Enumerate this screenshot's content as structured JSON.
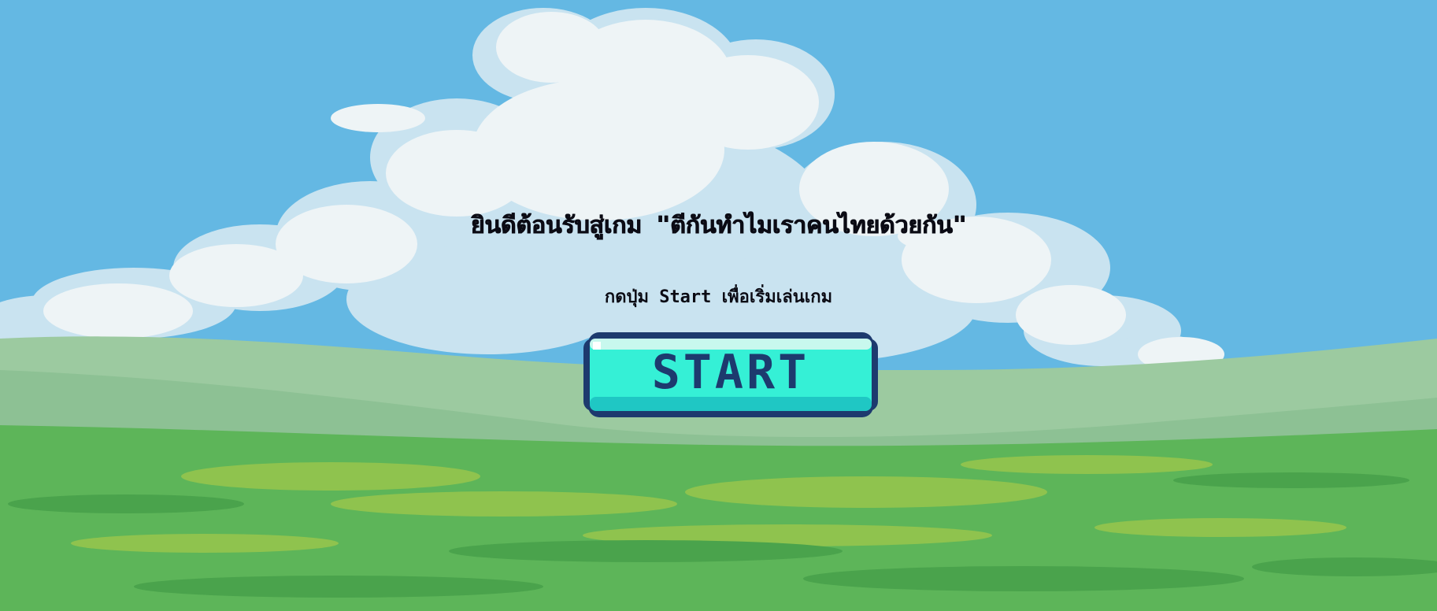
{
  "screen": {
    "title": "ยินดีต้อนรับสู่เกม \"ตีกันทำไมเราคนไทยด้วยกัน\"",
    "subtitle": "กดปุ่ม Start เพื่อเริ่มเล่นเกม",
    "start_button_label": "START"
  },
  "colors": {
    "sky": "#64b8e3",
    "cloud": "#eef4f6",
    "cloud_shade": "#c9e3f0",
    "far_hill": "#9ccaa0",
    "grass": "#5db559",
    "button_fill": "#35f0d6",
    "button_border": "#1d3a6e",
    "text": "#0b0b14"
  },
  "icons": {
    "background": "pixel-landscape"
  }
}
